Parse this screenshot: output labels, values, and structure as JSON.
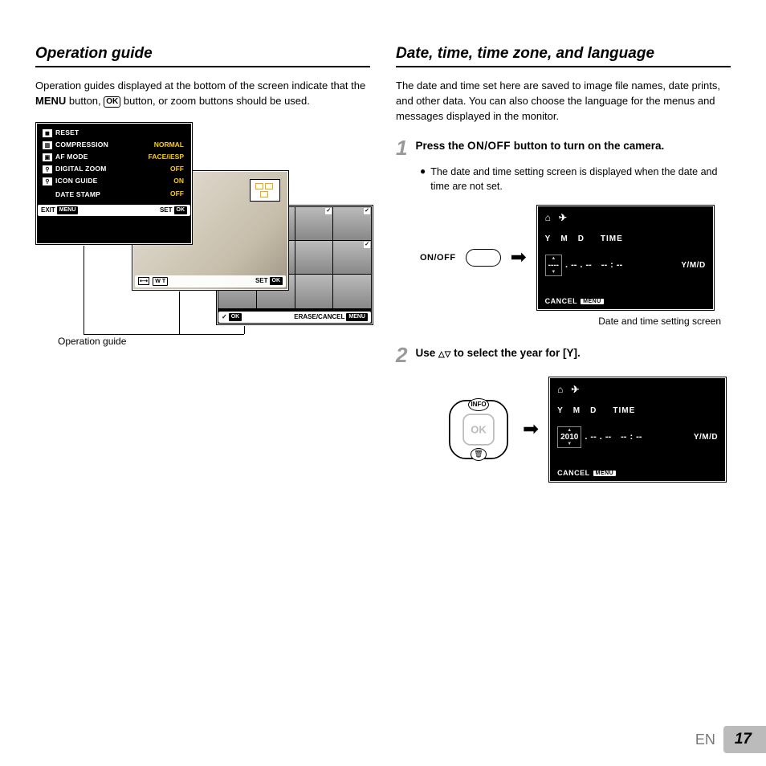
{
  "left": {
    "title": "Operation guide",
    "intro_a": "Operation guides displayed at the bottom of the screen indicate that the ",
    "intro_menu": "MENU",
    "intro_b": " button, ",
    "intro_ok": "OK",
    "intro_c": " button, or zoom buttons should be used.",
    "menu": {
      "rows": [
        {
          "label": "RESET",
          "value": ""
        },
        {
          "label": "COMPRESSION",
          "value": "NORMAL"
        },
        {
          "label": "AF MODE",
          "value": "FACE/iESP"
        },
        {
          "label": "DIGITAL ZOOM",
          "value": "OFF"
        },
        {
          "label": "ICON GUIDE",
          "value": "ON"
        },
        {
          "label": "DATE STAMP",
          "value": "OFF"
        }
      ],
      "footer_left": "EXIT",
      "footer_left_tag": "MENU",
      "footer_right": "SET",
      "footer_right_tag": "OK"
    },
    "photo": {
      "footer_left_icon": "W T",
      "footer_right": "SET",
      "footer_right_tag": "OK"
    },
    "thumbs": {
      "footer_left": "OK",
      "footer_right": "ERASE/CANCEL",
      "footer_right_tag": "MENU"
    },
    "caption": "Operation guide"
  },
  "right": {
    "title": "Date, time, time zone, and language",
    "intro": "The date and time set here are saved to image file names, date prints, and other data. You can also choose the language for the menus and messages displayed in the monitor.",
    "step1_num": "1",
    "step1_a": "Press the ",
    "step1_onoff": "ON/OFF",
    "step1_b": " button to turn on the camera.",
    "step1_bullet": "The date and time setting screen is displayed when the date and time are not set.",
    "onoff_label": "ON/OFF",
    "dt": {
      "head_y": "Y",
      "head_m": "M",
      "head_d": "D",
      "head_time": "TIME",
      "y_blank": "----",
      "m_blank": "--",
      "d_blank": "--",
      "t1": "--",
      "t2": "--",
      "ymd": "Y/M/D",
      "cancel": "CANCEL",
      "cancel_tag": "MENU"
    },
    "dt_caption": "Date and time setting screen",
    "step2_num": "2",
    "step2_a": "Use ",
    "step2_b": " to select the year for [Y].",
    "dpad_info": "INFO",
    "dpad_ok": "OK",
    "dt2_year": "2010"
  },
  "footer": {
    "lang": "EN",
    "page": "17"
  }
}
